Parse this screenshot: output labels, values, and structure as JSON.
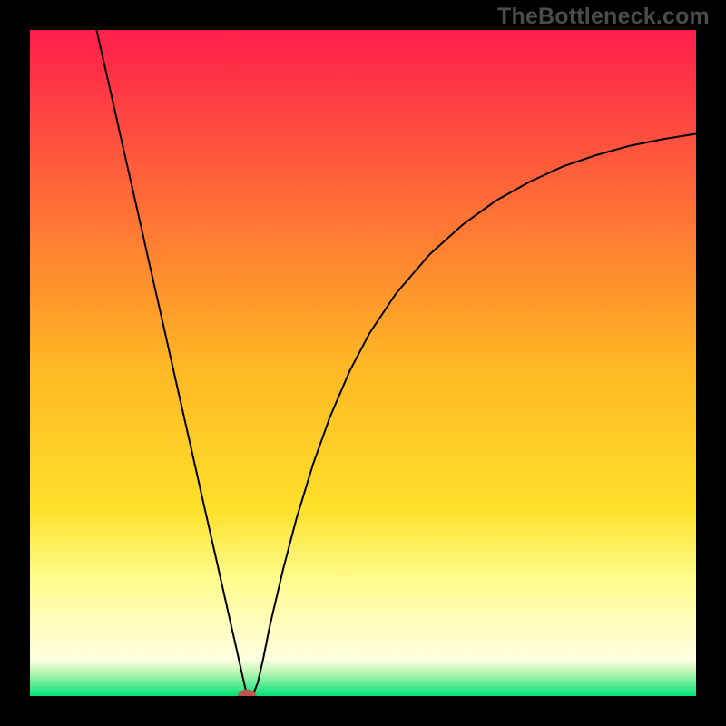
{
  "watermark": "TheBottleneck.com",
  "chart_data": {
    "type": "line",
    "title": "",
    "xlabel": "",
    "ylabel": "",
    "xlim": [
      0,
      100
    ],
    "ylim": [
      0,
      100
    ],
    "grid": false,
    "legend": false,
    "background_gradient": {
      "stops": [
        {
          "pos": 0.0,
          "color": "#ff1e4b"
        },
        {
          "pos": 0.5,
          "color": "#ffb624"
        },
        {
          "pos": 0.72,
          "color": "#ffe12a"
        },
        {
          "pos": 0.82,
          "color": "#fffb8a"
        },
        {
          "pos": 0.945,
          "color": "#ffffe2"
        },
        {
          "pos": 0.965,
          "color": "#b8f5b0"
        },
        {
          "pos": 1.0,
          "color": "#00e277"
        }
      ]
    },
    "marker": {
      "x": 32.6,
      "y": 0.0,
      "color": "#c0554e",
      "rx": 1.4,
      "ry": 1.0
    },
    "series": [
      {
        "name": "curve",
        "color": "#000000",
        "width": 2,
        "x": [
          10.0,
          12.0,
          14.0,
          16.0,
          18.0,
          20.0,
          22.0,
          24.0,
          26.0,
          28.0,
          30.0,
          31.0,
          31.8,
          32.6,
          33.4,
          34.2,
          35.0,
          36.0,
          38.0,
          40.0,
          42.5,
          45.0,
          48.0,
          51.0,
          55.0,
          60.0,
          65.0,
          70.0,
          75.0,
          80.0,
          85.0,
          90.0,
          95.0,
          100.0
        ],
        "y": [
          100.0,
          91.2,
          82.3,
          73.5,
          64.6,
          55.8,
          46.9,
          38.1,
          29.2,
          20.4,
          11.5,
          7.1,
          3.5,
          0.0,
          0.0,
          2.0,
          5.5,
          10.5,
          19.0,
          26.6,
          34.8,
          41.8,
          48.8,
          54.5,
          60.5,
          66.3,
          70.8,
          74.4,
          77.2,
          79.5,
          81.2,
          82.6,
          83.6,
          84.4
        ]
      }
    ]
  }
}
